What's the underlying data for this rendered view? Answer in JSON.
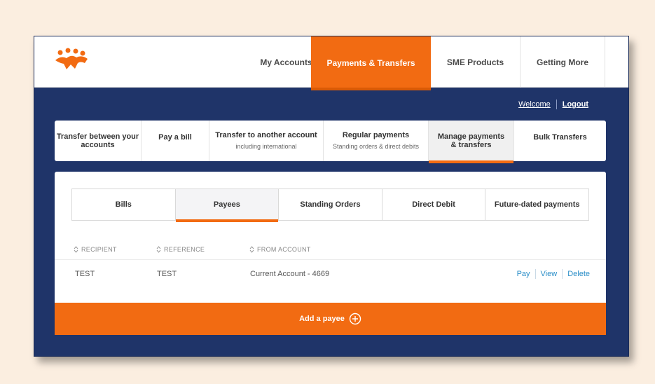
{
  "colors": {
    "accent": "#f26b12",
    "navy": "#1f3469",
    "link": "#2a8ec8"
  },
  "logo": {
    "icon": "people-group-logo"
  },
  "top_nav": [
    {
      "label": "My Accounts"
    },
    {
      "label": "Payments & Transfers"
    },
    {
      "label": "SME Products"
    },
    {
      "label": "Getting More"
    }
  ],
  "header": {
    "welcome": "Welcome",
    "logout": "Logout"
  },
  "sub_nav": [
    {
      "label": "Transfer between your accounts",
      "sub": ""
    },
    {
      "label": "Pay a bill",
      "sub": ""
    },
    {
      "label": "Transfer to another account",
      "sub": "including international"
    },
    {
      "label": "Regular payments",
      "sub": "Standing orders & direct debits"
    },
    {
      "label": "Manage payments & transfers",
      "sub": ""
    },
    {
      "label": "Bulk Transfers",
      "sub": ""
    }
  ],
  "tabs": [
    {
      "label": "Bills"
    },
    {
      "label": "Payees"
    },
    {
      "label": "Standing Orders"
    },
    {
      "label": "Direct Debit"
    },
    {
      "label": "Future-dated payments"
    }
  ],
  "table": {
    "columns": [
      "RECIPIENT",
      "REFERENCE",
      "FROM ACCOUNT"
    ],
    "rows": [
      {
        "recipient": "TEST",
        "reference": "TEST",
        "from_account": "Current Account - 4669"
      }
    ],
    "actions": [
      "Pay",
      "View",
      "Delete"
    ]
  },
  "add_payee": {
    "label": "Add a payee",
    "icon": "plus-circle-icon"
  }
}
